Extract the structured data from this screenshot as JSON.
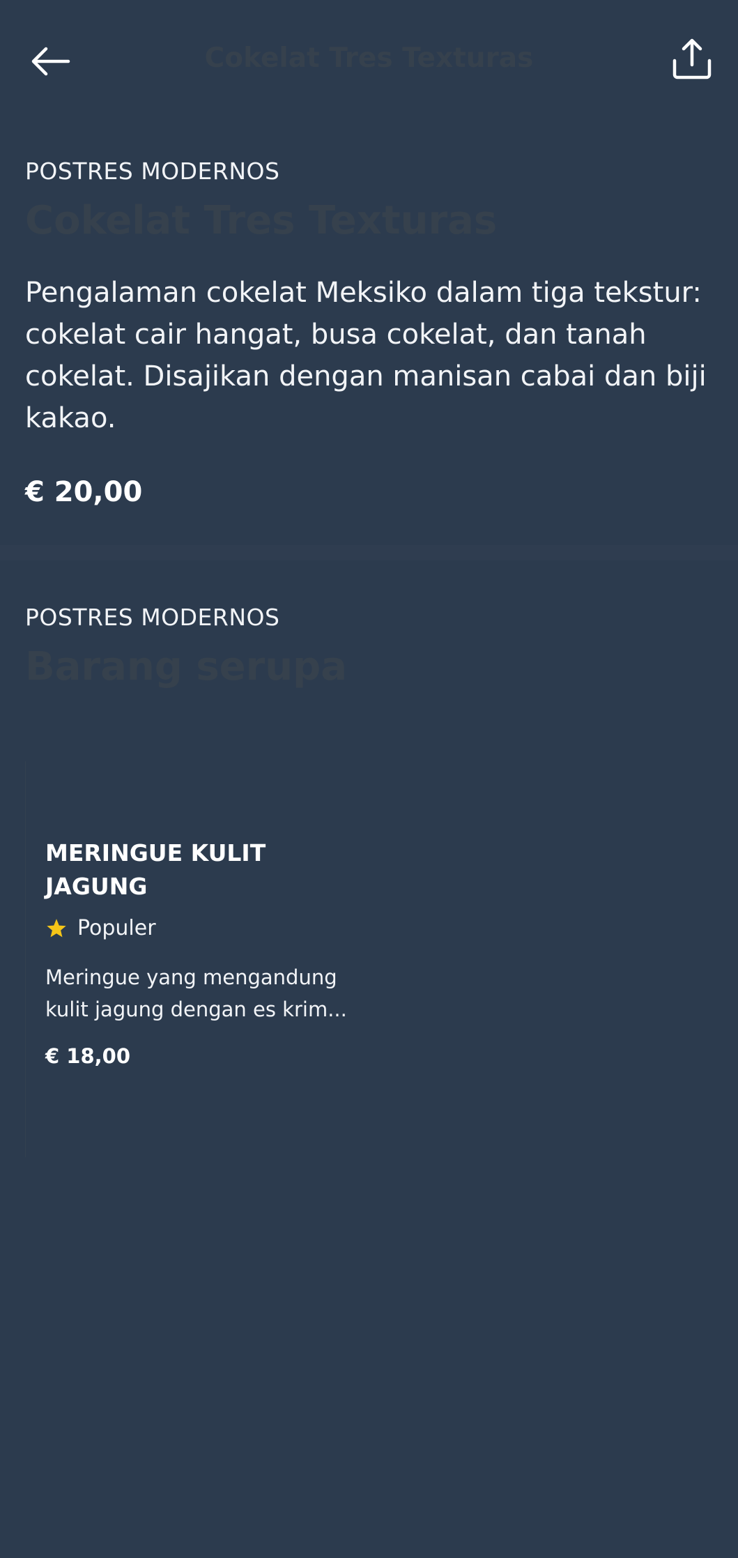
{
  "header": {
    "title": "Cokelat Tres Texturas"
  },
  "item": {
    "category": "POSTRES MODERNOS",
    "name": "Cokelat Tres Texturas",
    "description": "Pengalaman cokelat Meksiko dalam tiga tekstur: cokelat cair hangat, busa cokelat, dan tanah cokelat. Disajikan dengan manisan cabai dan biji kakao.",
    "price": "€ 20,00"
  },
  "similar": {
    "category": "POSTRES MODERNOS",
    "heading": "Barang serupa",
    "items": [
      {
        "name": "MERINGUE KULIT JAGUNG",
        "badge": "Populer",
        "description": "Meringue yang mengandung kulit jagung dengan es krim...",
        "price": "€ 18,00"
      }
    ]
  },
  "colors": {
    "background": "#2c3b4e",
    "star": "#f5c518"
  },
  "icons": {
    "back": "arrow-left-icon",
    "share": "share-icon",
    "badge": "star-icon"
  }
}
